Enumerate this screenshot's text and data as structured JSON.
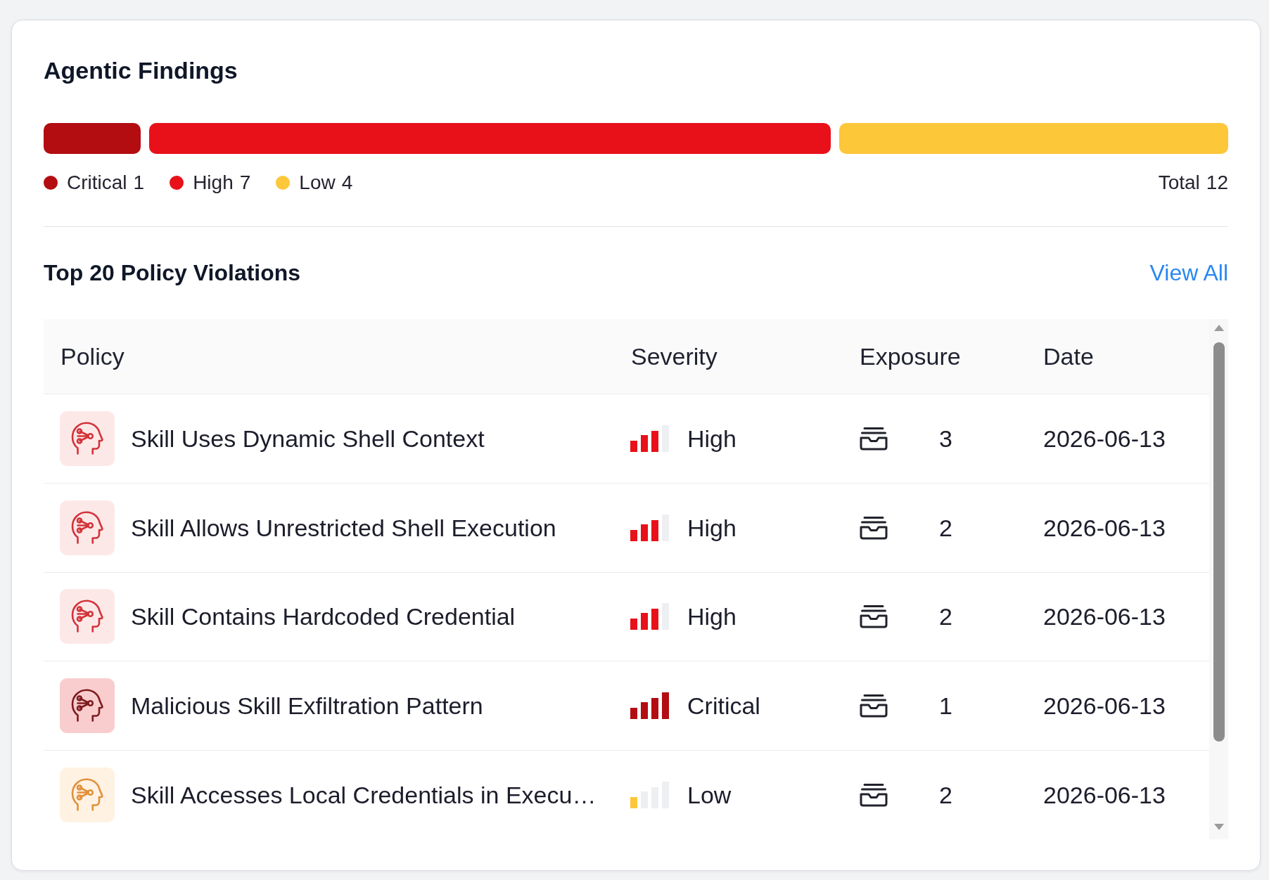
{
  "findings": {
    "title": "Agentic Findings",
    "segments": [
      {
        "label": "Critical",
        "count": "1",
        "color": "#b30d12"
      },
      {
        "label": "High",
        "count": "7",
        "color": "#e8111a"
      },
      {
        "label": "Low",
        "count": "4",
        "color": "#fdc73a"
      }
    ],
    "total": {
      "label": "Total",
      "count": "12"
    }
  },
  "violations": {
    "title": "Top 20 Policy Violations",
    "link": "View All",
    "table": {
      "columns": [
        "Policy",
        "Severity",
        "Exposure",
        "Date"
      ],
      "rows": [
        {
          "policy": "Skill Uses Dynamic Shell Context",
          "severity": {
            "kind": "high",
            "label": "High"
          },
          "exposure": "3",
          "date": "2026-06-13"
        },
        {
          "policy": "Skill Allows Unrestricted Shell Execution",
          "severity": {
            "kind": "high",
            "label": "High"
          },
          "exposure": "2",
          "date": "2026-06-13"
        },
        {
          "policy": "Skill Contains Hardcoded Credential",
          "severity": {
            "kind": "high",
            "label": "High"
          },
          "exposure": "2",
          "date": "2026-06-13"
        },
        {
          "policy": "Malicious Skill Exfiltration Pattern",
          "severity": {
            "kind": "critical",
            "label": "Critical"
          },
          "exposure": "1",
          "date": "2026-06-13"
        },
        {
          "policy": "Skill Accesses Local Credentials in Execu…",
          "severity": {
            "kind": "low",
            "label": "Low"
          },
          "exposure": "2",
          "date": "2026-06-13"
        }
      ]
    }
  }
}
